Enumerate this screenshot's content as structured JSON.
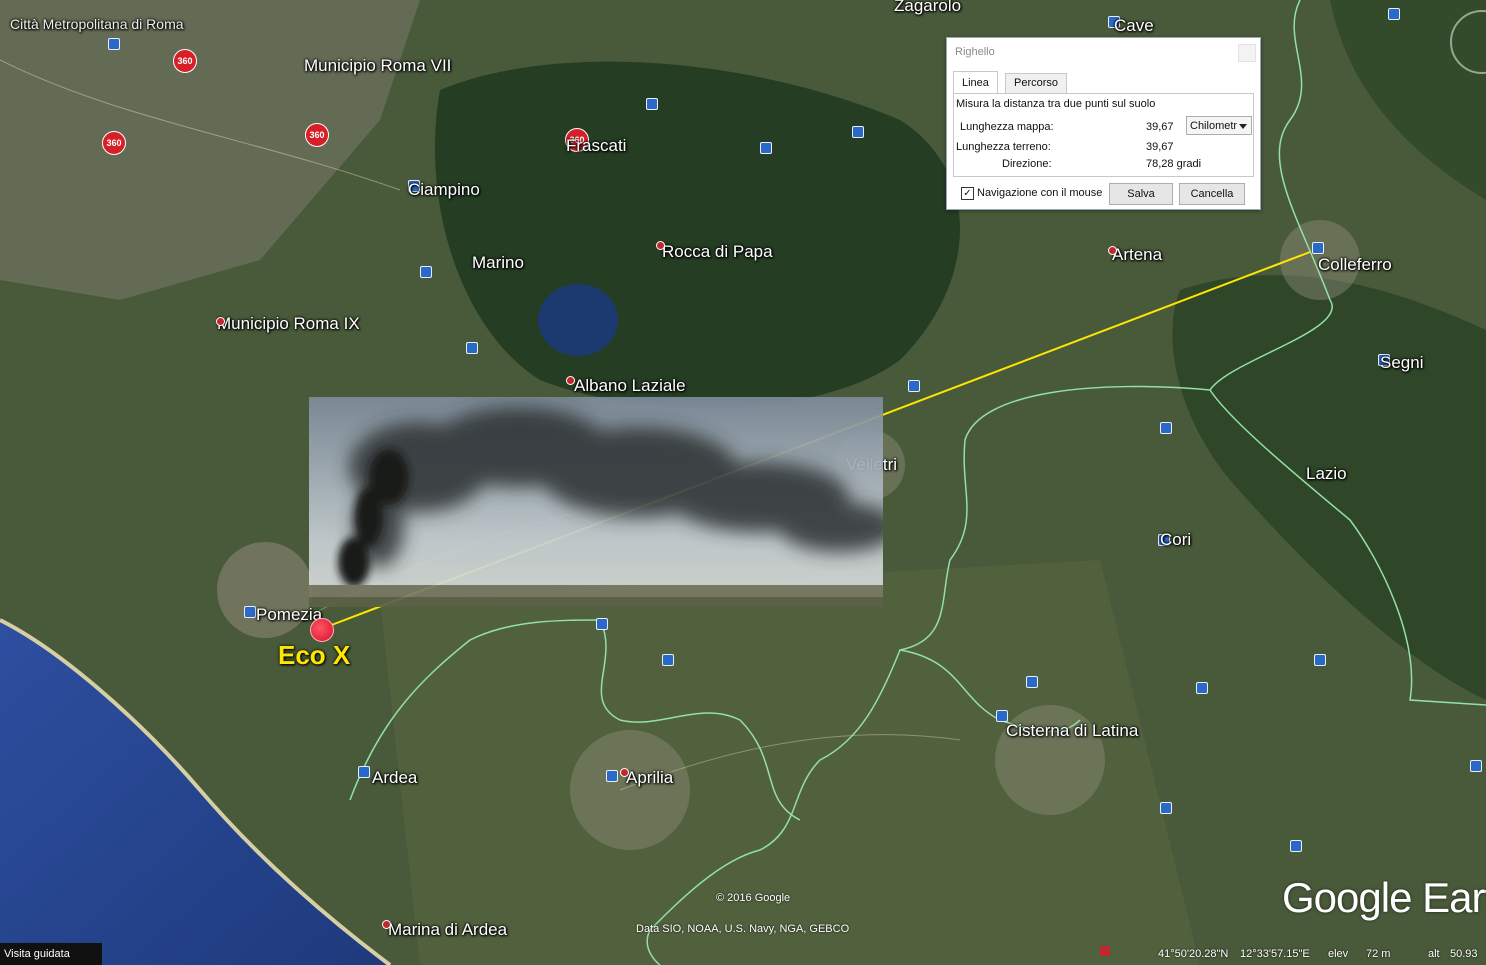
{
  "map": {
    "places": [
      {
        "name": "Città Metropolitana di Roma",
        "kind": "region-small"
      },
      {
        "name": "Zagarolo",
        "kind": "town"
      },
      {
        "name": "Cave",
        "kind": "town"
      },
      {
        "name": "Municipio Roma VII",
        "kind": "town"
      },
      {
        "name": "Frascati",
        "kind": "town"
      },
      {
        "name": "Ciampino",
        "kind": "town"
      },
      {
        "name": "Marino",
        "kind": "town"
      },
      {
        "name": "Rocca di Papa",
        "kind": "town"
      },
      {
        "name": "Artena",
        "kind": "town"
      },
      {
        "name": "Colleferro",
        "kind": "town"
      },
      {
        "name": "Municipio Roma IX",
        "kind": "town"
      },
      {
        "name": "Albano Laziale",
        "kind": "town"
      },
      {
        "name": "Segni",
        "kind": "town"
      },
      {
        "name": "Velletri",
        "kind": "town"
      },
      {
        "name": "Lazio",
        "kind": "region"
      },
      {
        "name": "Cori",
        "kind": "town"
      },
      {
        "name": "Pomezia",
        "kind": "town"
      },
      {
        "name": "Cisterna di Latina",
        "kind": "town"
      },
      {
        "name": "Ardea",
        "kind": "town"
      },
      {
        "name": "Aprilia",
        "kind": "town"
      },
      {
        "name": "Marina di Ardea",
        "kind": "town"
      }
    ],
    "marker_label": "Eco X",
    "badge_text": "360",
    "copyright": "© 2016 Google",
    "credits": "Data SIO, NOAA, U.S. Navy, NGA, GEBCO",
    "brand": "Google Earth",
    "line_color": "#ffe600",
    "marker_color": "#d6102c",
    "label_color": "#ffe600"
  },
  "ruler": {
    "title": "Righello",
    "tabs": [
      {
        "label": "Linea",
        "active": true
      },
      {
        "label": "Percorso",
        "active": false
      }
    ],
    "description": "Misura la distanza tra due punti sul suolo",
    "map_length_label": "Lunghezza mappa:",
    "map_length_value": "39,67",
    "unit_selected": "Chilometr",
    "ground_length_label": "Lunghezza terreno:",
    "ground_length_value": "39,67",
    "heading_label": "Direzione:",
    "heading_value": "78,28 gradi",
    "mouse_nav_label": "Navigazione con il mouse",
    "mouse_nav_checked": true,
    "save_label": "Salva",
    "cancel_label": "Cancella"
  },
  "statusbar": {
    "tour_label": "Visita guidata",
    "lat": "41°50'20.28\"N",
    "lon": "12°33'57.15\"E",
    "elev_label": "elev",
    "elev_value": "72 m",
    "alt_label": "alt",
    "alt_value": "50.93"
  }
}
